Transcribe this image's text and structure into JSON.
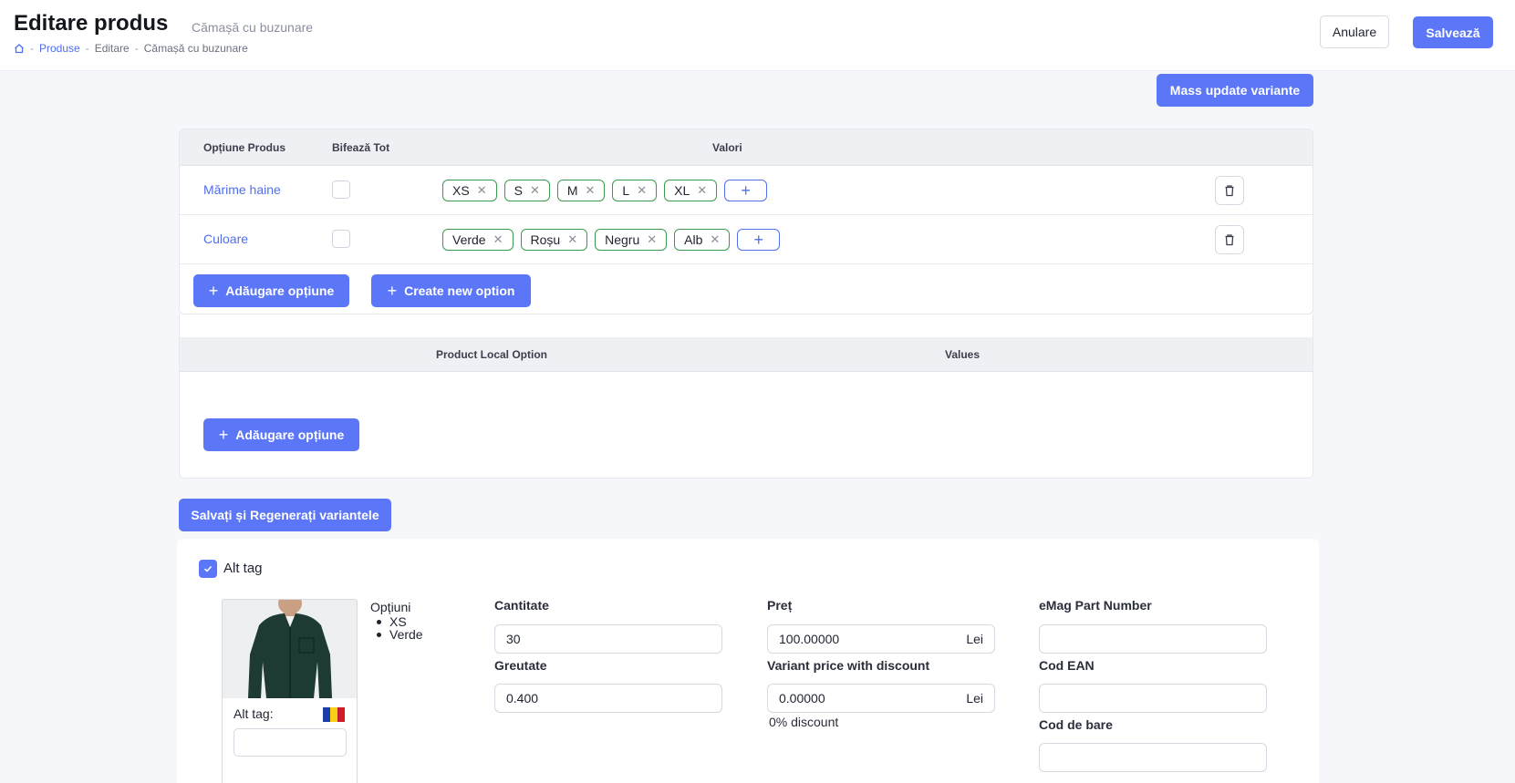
{
  "header": {
    "title": "Editare produs",
    "subtitle": "Cămașă cu buzunare",
    "breadcrumb": [
      "Produse",
      "Editare",
      "Cămașă cu buzunare"
    ],
    "cancel_label": "Anulare",
    "save_label": "Salvează"
  },
  "mass_update_label": "Mass update variante",
  "options_table": {
    "headers": [
      "Opțiune Produs",
      "Bifează Tot",
      "Valori"
    ],
    "rows": [
      {
        "name": "Mărime haine",
        "values": [
          "XS",
          "S",
          "M",
          "L",
          "XL"
        ]
      },
      {
        "name": "Culoare",
        "values": [
          "Verde",
          "Roșu",
          "Negru",
          "Alb"
        ]
      }
    ],
    "add_option_label": "Adăugare opțiune",
    "create_option_label": "Create new option"
  },
  "local_options_table": {
    "headers": [
      "Product Local Option",
      "Values"
    ],
    "add_option_label": "Adăugare opțiune"
  },
  "save_regenerate_label": "Salvați și Regenerați variantele",
  "variant": {
    "alt_tag_checkbox_label": "Alt tag",
    "image_alt_label": "Alt tag:",
    "options_title": "Opțiuni",
    "options": [
      "XS",
      "Verde"
    ],
    "fields": {
      "quantity": {
        "label": "Cantitate",
        "value": "30"
      },
      "weight": {
        "label": "Greutate",
        "value": "0.400"
      },
      "price": {
        "label": "Preț",
        "value": "100.00000",
        "suffix": "Lei"
      },
      "discount_price": {
        "label": "Variant price with discount",
        "value": "0.00000",
        "suffix": "Lei"
      },
      "discount_hint": "0% discount",
      "emag_part": {
        "label": "eMag Part Number",
        "value": ""
      },
      "ean": {
        "label": "Cod EAN",
        "value": ""
      },
      "barcode": {
        "label": "Cod de bare",
        "value": ""
      }
    }
  },
  "colors": {
    "primary": "#5b76f7",
    "chip_border": "#3a9a4b",
    "link": "#4f6ef0"
  }
}
